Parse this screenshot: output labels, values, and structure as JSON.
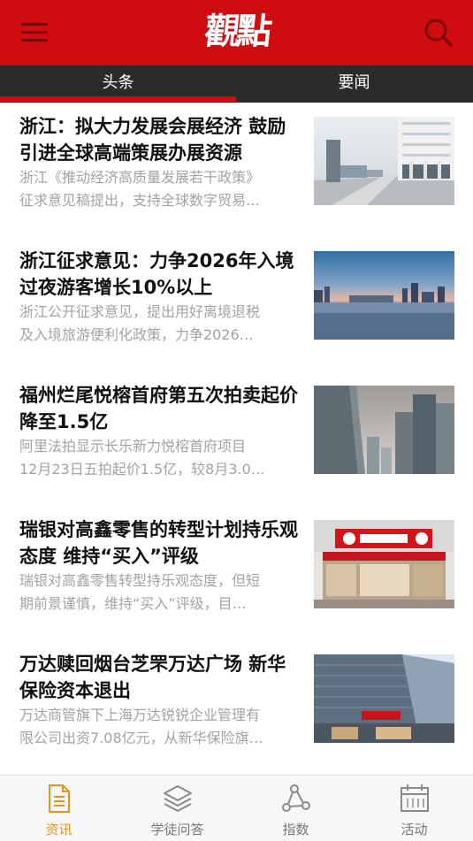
{
  "header": {
    "logo_text": "觀點",
    "menu_icon": "hamburger-menu-icon",
    "search_icon": "search-icon",
    "bg_color": "#cf0c10"
  },
  "tabs": [
    {
      "label": "头条",
      "active": true
    },
    {
      "label": "要闻",
      "active": false
    }
  ],
  "articles": [
    {
      "title": "浙江：拟大力发展会展经济 鼓励引进全球高端策展办展资源",
      "summary_line1": "浙江《推动经济高质量发展若干政策》",
      "summary_line2": "征求意见稿提出，支持全球数字贸易…",
      "thumb": "modern-building-plaza-photo"
    },
    {
      "title": "浙江征求意见：力争2026年入境过夜游客增长10%以上",
      "summary_line1": "浙江公开征求意见，提出用好离境退税",
      "summary_line2": "及入境旅游便利化政策，力争2026…",
      "thumb": "city-skyline-waterfront-photo"
    },
    {
      "title": "福州烂尾悦榕首府第五次拍卖起价降至1.5亿",
      "summary_line1": "阿里法拍显示长乐新力悦榕首府项目",
      "summary_line2": "12月23日五拍起价1.5亿，较8月3.0…",
      "thumb": "skyscrapers-hazy-sky-photo"
    },
    {
      "title": "瑞银对高鑫零售的转型计划持乐观态度 维持“买入”评级",
      "summary_line1": "瑞银对高鑫零售转型持乐观态度，但短",
      "summary_line2": "期前景谨慎，维持“买入”评级，目…",
      "thumb": "rt-mart-storefront-photo"
    },
    {
      "title": "万达赎回烟台芝罘万达广场 新华保险资本退出",
      "summary_line1": "万达商管旗下上海万达锐锐企业管理有",
      "summary_line2": "限公司出资7.08亿元，从新华保险旗…",
      "thumb": "wanda-plaza-building-photo"
    }
  ],
  "bottom_nav": [
    {
      "label": "资讯",
      "icon": "document-icon",
      "active": true
    },
    {
      "label": "学徒问答",
      "icon": "layers-icon",
      "active": false
    },
    {
      "label": "指数",
      "icon": "network-nodes-icon",
      "active": false
    },
    {
      "label": "活动",
      "icon": "calendar-icon",
      "active": false
    }
  ],
  "colors": {
    "brand_red": "#cf0c10",
    "tab_bar": "#2b2b2b",
    "active_nav": "#e8931f",
    "summary_gray": "#a3a3a3"
  }
}
